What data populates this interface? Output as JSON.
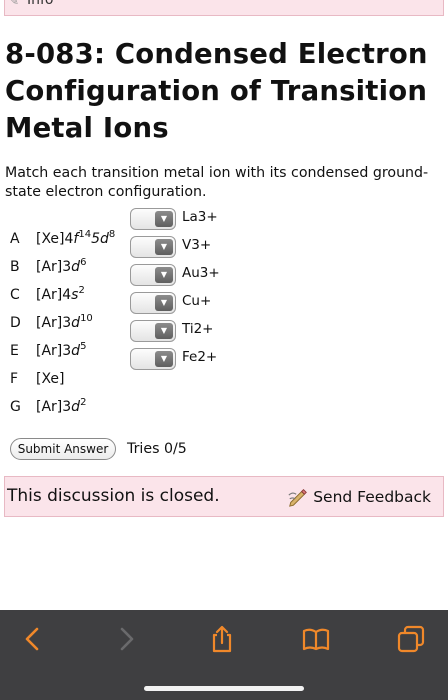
{
  "header": {
    "peek_text": "Info",
    "icon": "info-book-icon"
  },
  "title": "8-083: Condensed Electron Configuration of Transition Metal Ions",
  "instructions": "Match each transition metal ion with its condensed ground-state electron configuration.",
  "options": [
    {
      "letter": "A",
      "core": "[Xe]4",
      "parts": [
        [
          "f",
          "14"
        ],
        [
          "5d",
          "8"
        ]
      ]
    },
    {
      "letter": "B",
      "core": "[Ar]3",
      "parts": [
        [
          "d",
          "6"
        ]
      ]
    },
    {
      "letter": "C",
      "core": "[Ar]4",
      "parts": [
        [
          "s",
          "2"
        ]
      ]
    },
    {
      "letter": "D",
      "core": "[Ar]3",
      "parts": [
        [
          "d",
          "10"
        ]
      ]
    },
    {
      "letter": "E",
      "core": "[Ar]3",
      "parts": [
        [
          "d",
          "5"
        ]
      ]
    },
    {
      "letter": "F",
      "core": "[Xe]",
      "parts": []
    },
    {
      "letter": "G",
      "core": "[Ar]3",
      "parts": [
        [
          "d",
          "2"
        ]
      ]
    }
  ],
  "ions": [
    {
      "label": "La3+",
      "selected": ""
    },
    {
      "label": "V3+",
      "selected": ""
    },
    {
      "label": "Au3+",
      "selected": ""
    },
    {
      "label": "Cu+",
      "selected": ""
    },
    {
      "label": "Ti2+",
      "selected": ""
    },
    {
      "label": "Fe2+",
      "selected": ""
    }
  ],
  "submit_label": "Submit Answer",
  "tries_text": "Tries 0/5",
  "discussion_closed": "This discussion is closed.",
  "send_feedback": "Send Feedback",
  "colors": {
    "banner_bg": "#fbe4ea",
    "banner_border": "#e8b9c4",
    "browser_bar": "#3f3f41",
    "accent": "#f0882a",
    "disabled": "#6a6a6c"
  },
  "browser_toolbar": [
    "back-icon",
    "forward-icon",
    "share-icon",
    "bookmarks-icon",
    "tabs-icon"
  ]
}
